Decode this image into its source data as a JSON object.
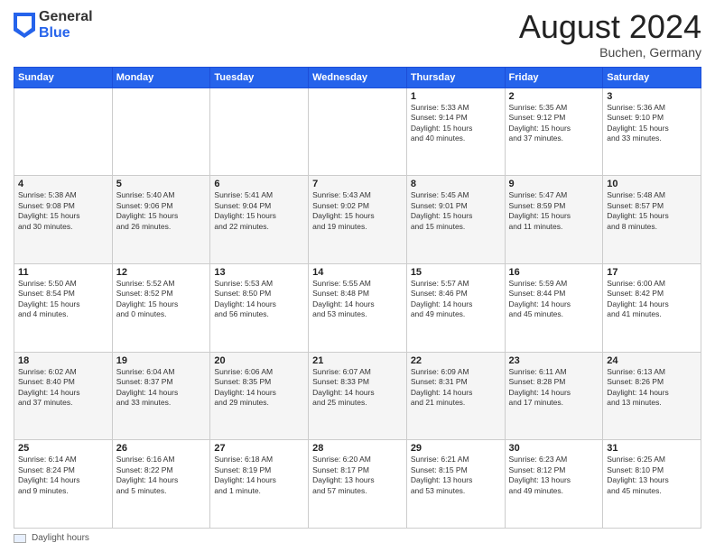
{
  "header": {
    "logo_general": "General",
    "logo_blue": "Blue",
    "month_title": "August 2024",
    "location": "Buchen, Germany"
  },
  "calendar": {
    "days_of_week": [
      "Sunday",
      "Monday",
      "Tuesday",
      "Wednesday",
      "Thursday",
      "Friday",
      "Saturday"
    ],
    "weeks": [
      [
        {
          "day": "",
          "info": ""
        },
        {
          "day": "",
          "info": ""
        },
        {
          "day": "",
          "info": ""
        },
        {
          "day": "",
          "info": ""
        },
        {
          "day": "1",
          "info": "Sunrise: 5:33 AM\nSunset: 9:14 PM\nDaylight: 15 hours\nand 40 minutes."
        },
        {
          "day": "2",
          "info": "Sunrise: 5:35 AM\nSunset: 9:12 PM\nDaylight: 15 hours\nand 37 minutes."
        },
        {
          "day": "3",
          "info": "Sunrise: 5:36 AM\nSunset: 9:10 PM\nDaylight: 15 hours\nand 33 minutes."
        }
      ],
      [
        {
          "day": "4",
          "info": "Sunrise: 5:38 AM\nSunset: 9:08 PM\nDaylight: 15 hours\nand 30 minutes."
        },
        {
          "day": "5",
          "info": "Sunrise: 5:40 AM\nSunset: 9:06 PM\nDaylight: 15 hours\nand 26 minutes."
        },
        {
          "day": "6",
          "info": "Sunrise: 5:41 AM\nSunset: 9:04 PM\nDaylight: 15 hours\nand 22 minutes."
        },
        {
          "day": "7",
          "info": "Sunrise: 5:43 AM\nSunset: 9:02 PM\nDaylight: 15 hours\nand 19 minutes."
        },
        {
          "day": "8",
          "info": "Sunrise: 5:45 AM\nSunset: 9:01 PM\nDaylight: 15 hours\nand 15 minutes."
        },
        {
          "day": "9",
          "info": "Sunrise: 5:47 AM\nSunset: 8:59 PM\nDaylight: 15 hours\nand 11 minutes."
        },
        {
          "day": "10",
          "info": "Sunrise: 5:48 AM\nSunset: 8:57 PM\nDaylight: 15 hours\nand 8 minutes."
        }
      ],
      [
        {
          "day": "11",
          "info": "Sunrise: 5:50 AM\nSunset: 8:54 PM\nDaylight: 15 hours\nand 4 minutes."
        },
        {
          "day": "12",
          "info": "Sunrise: 5:52 AM\nSunset: 8:52 PM\nDaylight: 15 hours\nand 0 minutes."
        },
        {
          "day": "13",
          "info": "Sunrise: 5:53 AM\nSunset: 8:50 PM\nDaylight: 14 hours\nand 56 minutes."
        },
        {
          "day": "14",
          "info": "Sunrise: 5:55 AM\nSunset: 8:48 PM\nDaylight: 14 hours\nand 53 minutes."
        },
        {
          "day": "15",
          "info": "Sunrise: 5:57 AM\nSunset: 8:46 PM\nDaylight: 14 hours\nand 49 minutes."
        },
        {
          "day": "16",
          "info": "Sunrise: 5:59 AM\nSunset: 8:44 PM\nDaylight: 14 hours\nand 45 minutes."
        },
        {
          "day": "17",
          "info": "Sunrise: 6:00 AM\nSunset: 8:42 PM\nDaylight: 14 hours\nand 41 minutes."
        }
      ],
      [
        {
          "day": "18",
          "info": "Sunrise: 6:02 AM\nSunset: 8:40 PM\nDaylight: 14 hours\nand 37 minutes."
        },
        {
          "day": "19",
          "info": "Sunrise: 6:04 AM\nSunset: 8:37 PM\nDaylight: 14 hours\nand 33 minutes."
        },
        {
          "day": "20",
          "info": "Sunrise: 6:06 AM\nSunset: 8:35 PM\nDaylight: 14 hours\nand 29 minutes."
        },
        {
          "day": "21",
          "info": "Sunrise: 6:07 AM\nSunset: 8:33 PM\nDaylight: 14 hours\nand 25 minutes."
        },
        {
          "day": "22",
          "info": "Sunrise: 6:09 AM\nSunset: 8:31 PM\nDaylight: 14 hours\nand 21 minutes."
        },
        {
          "day": "23",
          "info": "Sunrise: 6:11 AM\nSunset: 8:28 PM\nDaylight: 14 hours\nand 17 minutes."
        },
        {
          "day": "24",
          "info": "Sunrise: 6:13 AM\nSunset: 8:26 PM\nDaylight: 14 hours\nand 13 minutes."
        }
      ],
      [
        {
          "day": "25",
          "info": "Sunrise: 6:14 AM\nSunset: 8:24 PM\nDaylight: 14 hours\nand 9 minutes."
        },
        {
          "day": "26",
          "info": "Sunrise: 6:16 AM\nSunset: 8:22 PM\nDaylight: 14 hours\nand 5 minutes."
        },
        {
          "day": "27",
          "info": "Sunrise: 6:18 AM\nSunset: 8:19 PM\nDaylight: 14 hours\nand 1 minute."
        },
        {
          "day": "28",
          "info": "Sunrise: 6:20 AM\nSunset: 8:17 PM\nDaylight: 13 hours\nand 57 minutes."
        },
        {
          "day": "29",
          "info": "Sunrise: 6:21 AM\nSunset: 8:15 PM\nDaylight: 13 hours\nand 53 minutes."
        },
        {
          "day": "30",
          "info": "Sunrise: 6:23 AM\nSunset: 8:12 PM\nDaylight: 13 hours\nand 49 minutes."
        },
        {
          "day": "31",
          "info": "Sunrise: 6:25 AM\nSunset: 8:10 PM\nDaylight: 13 hours\nand 45 minutes."
        }
      ]
    ]
  },
  "footer": {
    "daylight_label": "Daylight hours"
  }
}
